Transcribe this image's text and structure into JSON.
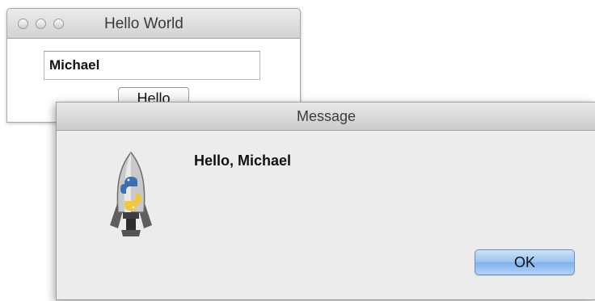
{
  "main_window": {
    "title": "Hello World",
    "name_input_value": "Michael",
    "hello_button_label": "Hello"
  },
  "dialog": {
    "title": "Message",
    "message": "Hello, Michael",
    "ok_button_label": "OK",
    "icon": "python-rocket-icon"
  },
  "colors": {
    "ok_button_accent": "#8fbdef",
    "titlebar": "#d9d9d9",
    "dialog_background": "#ececec"
  }
}
